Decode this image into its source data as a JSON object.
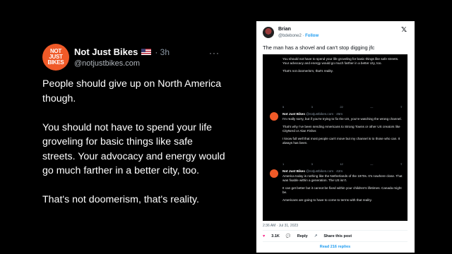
{
  "left_post": {
    "avatar_text": "NOT\nJUST\nBIKES",
    "author": "Not Just Bikes",
    "time": "· 3h",
    "handle": "@notjustbikes.com",
    "more": "···",
    "paragraphs": [
      "People should give up on North America though.",
      "You should not have to spend your life groveling for basic things like safe streets. Your advocacy and energy would go much farther in a better city, too.",
      "That's not doomerism, that's reality."
    ]
  },
  "screenshot": {
    "author": "Brian",
    "handle": "@bdebone2",
    "follow": "Follow",
    "text": "The man has a shovel and can't stop digging jfc",
    "quote_paragraphs": [
      "You should not have to spend your life groveling for basic things like safe streets. Your advocacy and energy would go much farther in a better city, too.",
      "That's not doomerism, that's reality."
    ],
    "quote_metrics": [
      "5",
      "3",
      "22",
      "—",
      "⇪"
    ],
    "replies": [
      {
        "author": "Not Just Bikes",
        "handle": "@notjustbikes.com · 45m",
        "paragraphs": [
          "I'm really sorry, but if you're trying to fix the US, you're watching the wrong channel.",
          "That's why I've been sending Americans to Strong Towns or other US creators like CityNerd or Alan Fisher.",
          "I know full well that most people can't move but my channel is to those who can. It always has been."
        ],
        "metrics": [
          "1",
          "3",
          "12",
          "—",
          "⇪"
        ]
      },
      {
        "author": "Not Just Bikes",
        "handle": "@notjustbikes.com · 42m",
        "paragraphs": [
          "America today is nothing like the Netherlands of the 1970s. It's nowhere close. That was fixable within a generation. The US isn't.",
          "It can get better but it cannot be fixed within your children's lifetimes. Canada might be.",
          "Americans are going to have to come to terms with that reality."
        ]
      }
    ],
    "meta": "2:36 AM · Jul 31, 2023",
    "likes": "3.1K",
    "reply_label": "Reply",
    "share_label": "Share this post",
    "read_replies": "Read 216 replies"
  }
}
